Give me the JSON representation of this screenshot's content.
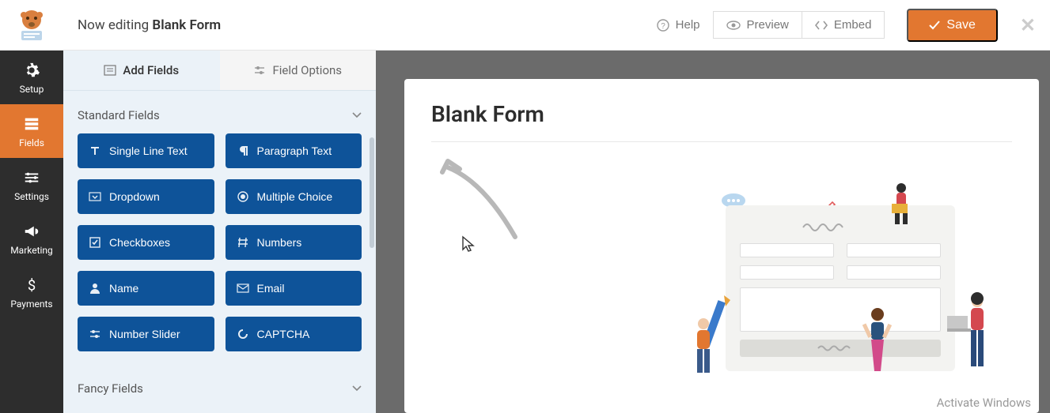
{
  "header": {
    "editing_prefix": "Now editing ",
    "form_name": "Blank Form",
    "help": "Help",
    "preview": "Preview",
    "embed": "Embed",
    "save": "Save"
  },
  "nav": {
    "setup": "Setup",
    "fields": "Fields",
    "settings": "Settings",
    "marketing": "Marketing",
    "payments": "Payments"
  },
  "panel": {
    "tab_add": "Add Fields",
    "tab_options": "Field Options",
    "standard_heading": "Standard Fields",
    "fancy_heading": "Fancy Fields",
    "fields": {
      "single_line": "Single Line Text",
      "paragraph": "Paragraph Text",
      "dropdown": "Dropdown",
      "multiple_choice": "Multiple Choice",
      "checkboxes": "Checkboxes",
      "numbers": "Numbers",
      "name": "Name",
      "email": "Email",
      "number_slider": "Number Slider",
      "captcha": "CAPTCHA"
    }
  },
  "canvas": {
    "title": "Blank Form"
  },
  "watermark": "Activate Windows"
}
